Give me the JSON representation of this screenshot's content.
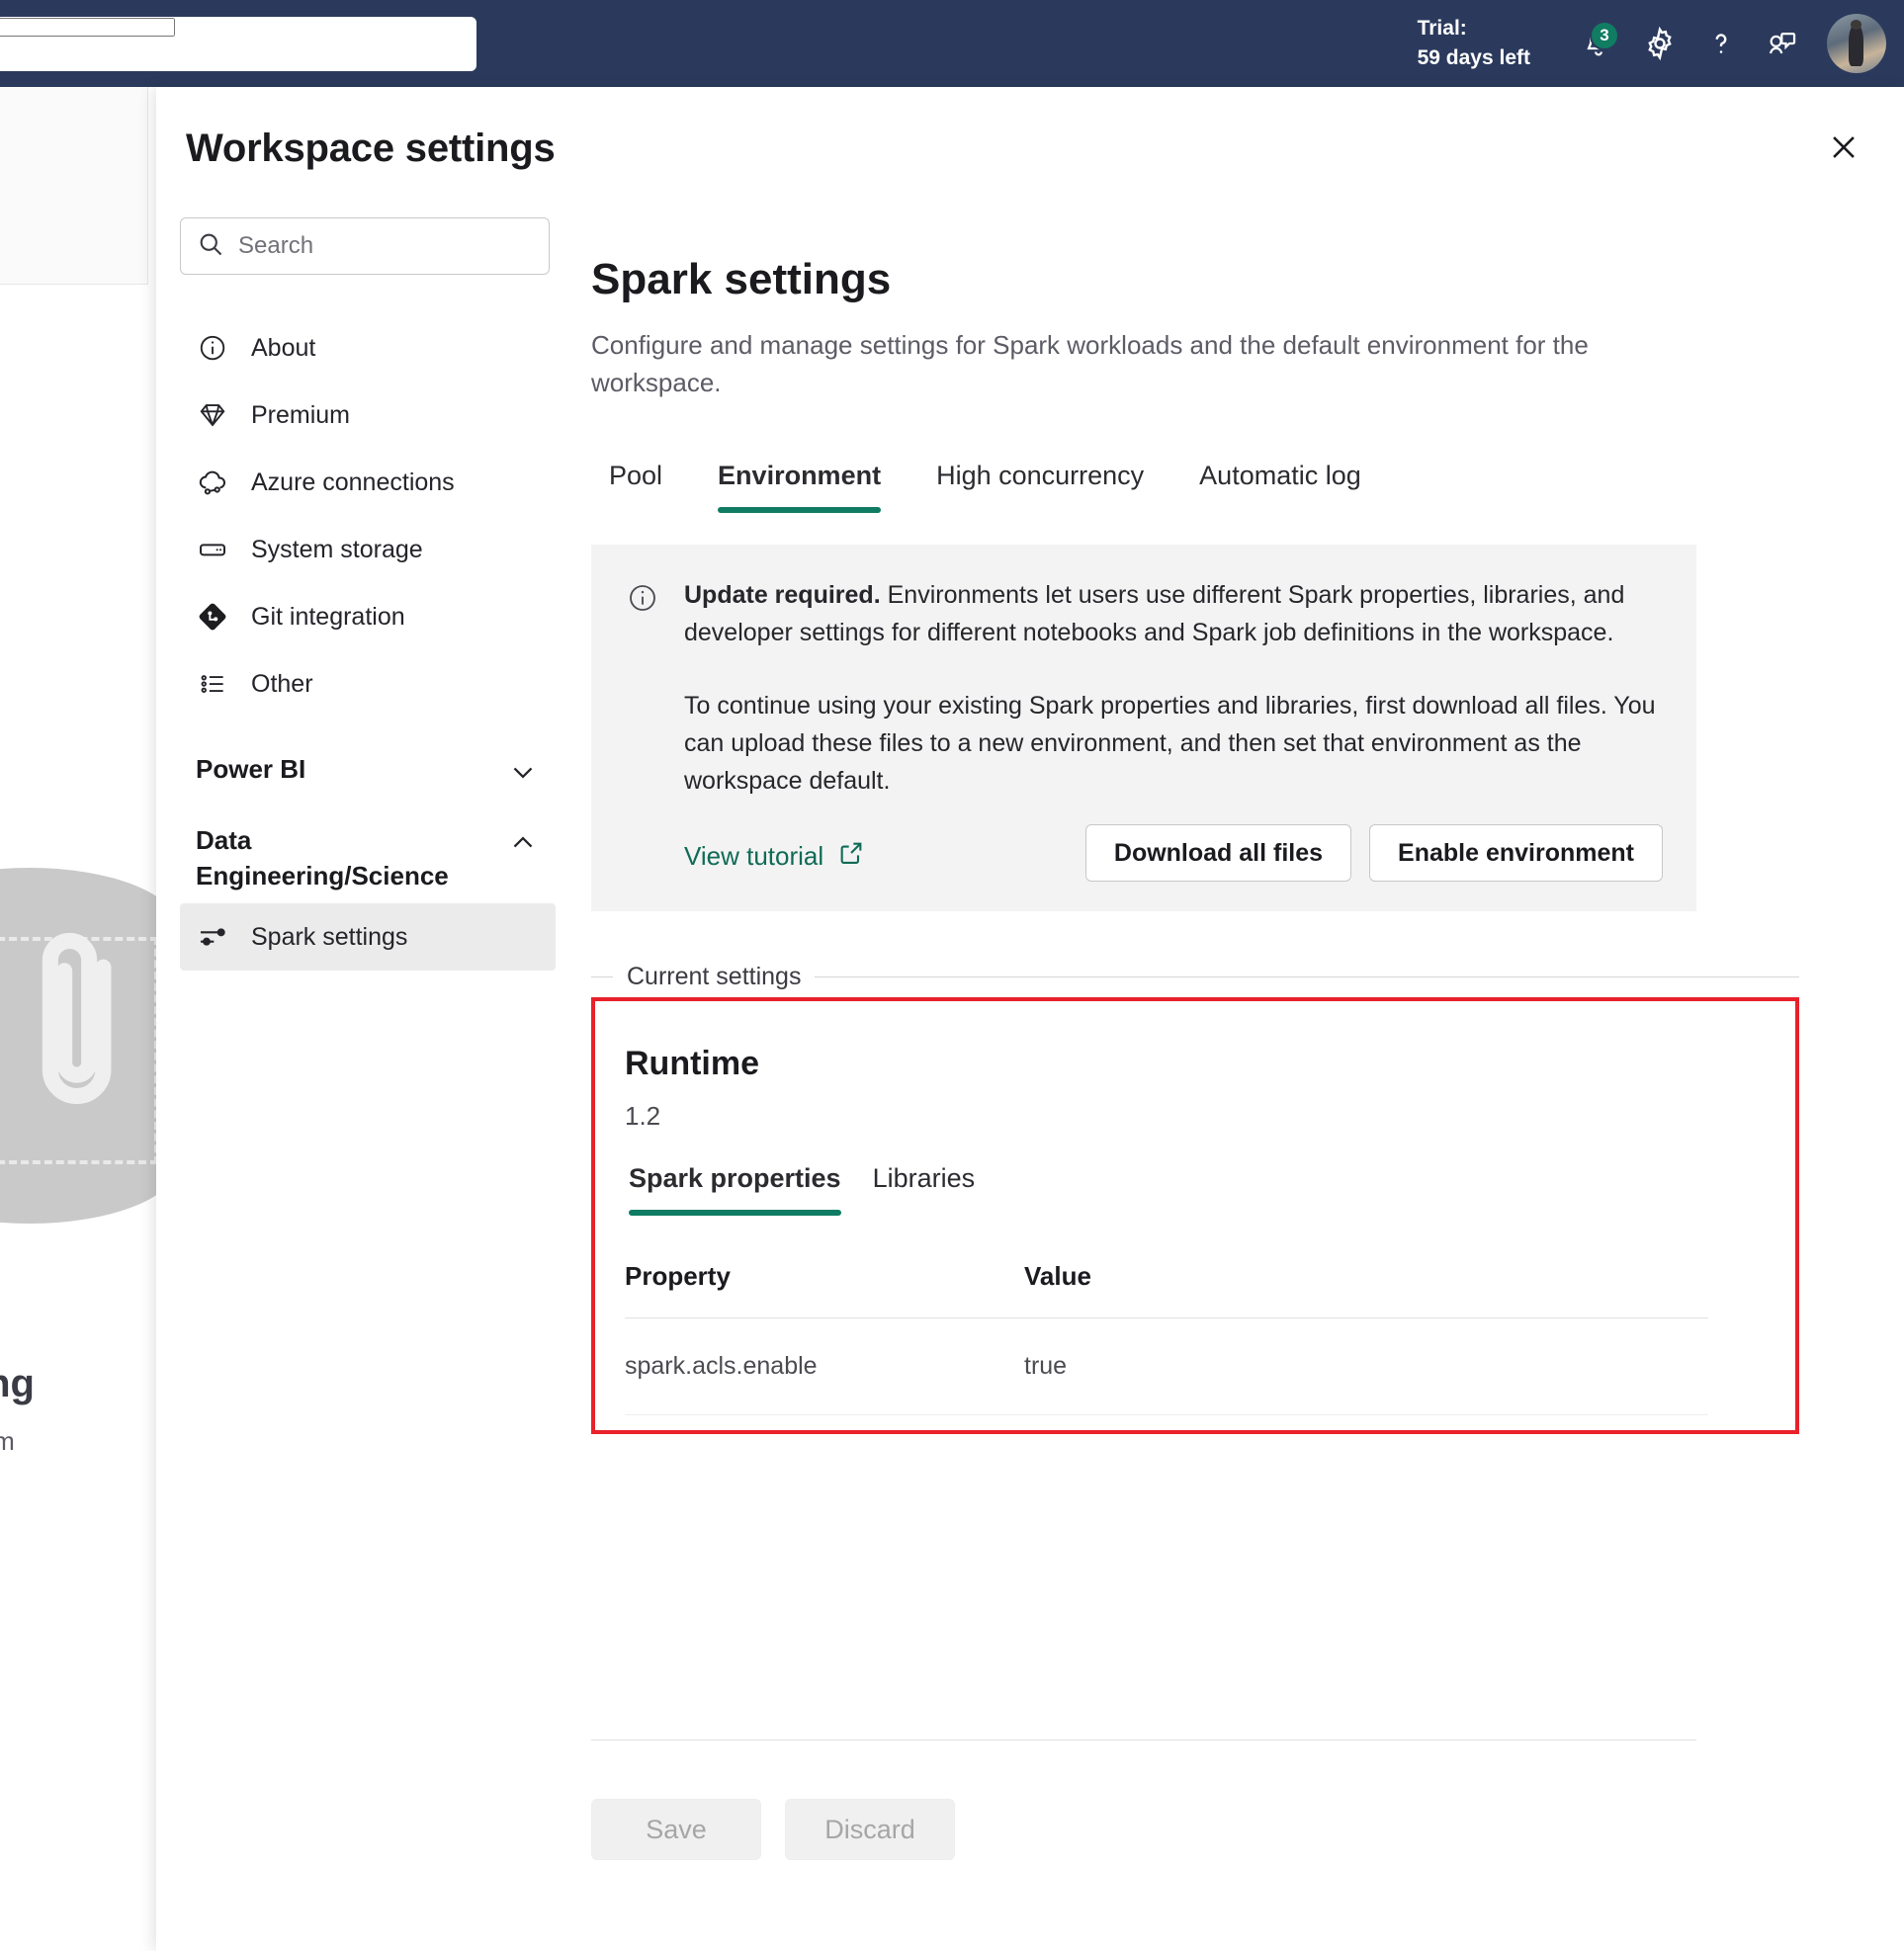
{
  "topbar": {
    "search_placeholder": "",
    "trial_line1": "Trial:",
    "trial_line2": "59 days left",
    "notification_count": "3",
    "icons": {
      "bell": "bell-icon",
      "gear": "gear-icon",
      "help": "help-icon",
      "feedback": "feedback-icon",
      "avatar": "user-avatar"
    }
  },
  "background": {
    "headline": "s nothing",
    "subtext": "or upload som"
  },
  "dialog": {
    "title": "Workspace settings",
    "close_label": "Close"
  },
  "sidebar": {
    "search_placeholder": "Search",
    "items": [
      {
        "label": "About",
        "icon": "info-icon"
      },
      {
        "label": "Premium",
        "icon": "diamond-icon"
      },
      {
        "label": "Azure connections",
        "icon": "cloud-link-icon"
      },
      {
        "label": "System storage",
        "icon": "storage-icon"
      },
      {
        "label": "Git integration",
        "icon": "git-icon"
      },
      {
        "label": "Other",
        "icon": "list-icon"
      }
    ],
    "groups": [
      {
        "label": "Power BI",
        "expanded": false,
        "chevron": "chevron-down-icon",
        "items": []
      },
      {
        "label": "Data Engineering/Science",
        "expanded": true,
        "chevron": "chevron-up-icon",
        "items": [
          {
            "label": "Spark settings",
            "icon": "sliders-icon",
            "selected": true
          }
        ]
      }
    ]
  },
  "main": {
    "title": "Spark settings",
    "subtitle": "Configure and manage settings for Spark workloads and the default environment for the workspace.",
    "tabs": [
      {
        "label": "Pool",
        "active": false
      },
      {
        "label": "Environment",
        "active": true
      },
      {
        "label": "High concurrency",
        "active": false
      },
      {
        "label": "Automatic log",
        "active": false
      }
    ],
    "banner": {
      "icon": "info-icon",
      "strong": "Update required.",
      "text1": "Environments let users use different Spark properties, libraries, and developer settings for different notebooks and Spark job definitions in the workspace.",
      "text2": "To continue using your existing Spark properties and libraries, first download all files. You can upload these files to a new environment, and then set that environment as the workspace default.",
      "link_label": "View tutorial",
      "link_icon": "external-link-icon",
      "button_download": "Download all files",
      "button_enable": "Enable environment"
    },
    "current_settings": {
      "legend": "Current settings",
      "runtime_label": "Runtime",
      "runtime_version": "1.2",
      "inner_tabs": [
        {
          "label": "Spark properties",
          "active": true
        },
        {
          "label": "Libraries",
          "active": false
        }
      ],
      "table": {
        "columns": [
          "Property",
          "Value"
        ],
        "rows": [
          {
            "property": "spark.acls.enable",
            "value": "true"
          }
        ]
      },
      "highlight_color": "#e8212b"
    },
    "footer": {
      "save_label": "Save",
      "discard_label": "Discard"
    }
  },
  "colors": {
    "topbar_bg": "#2b3a5c",
    "accent_teal": "#0f7b63",
    "badge_green": "#107c62",
    "highlight_red": "#e8212b"
  }
}
